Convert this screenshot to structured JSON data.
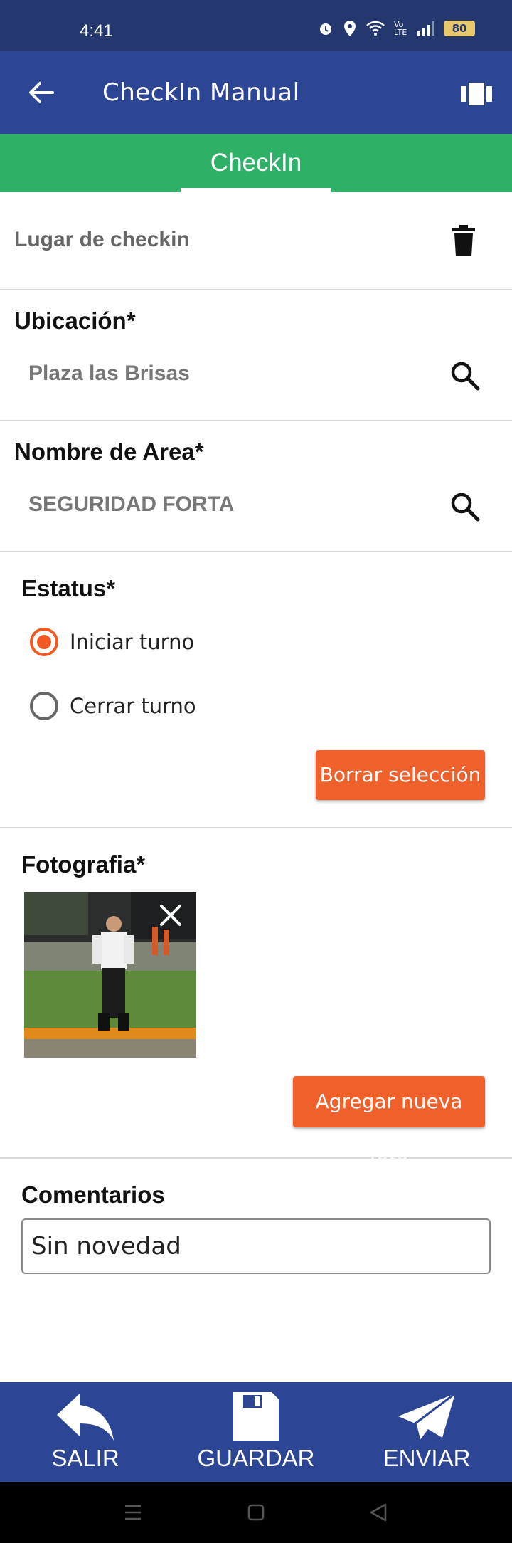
{
  "status_bar": {
    "time": "4:41",
    "battery": "80",
    "network": "Vo LTE"
  },
  "app_bar": {
    "title": "CheckIn Manual",
    "back_icon": "arrow-left-icon",
    "gallery_icon": "view-carousel-icon"
  },
  "tabs": [
    {
      "label": "CheckIn",
      "active": true
    }
  ],
  "place": {
    "label": "Lugar de checkin",
    "icon": "trash-icon"
  },
  "ubicacion": {
    "title": "Ubicación*",
    "value": "Plaza las Brisas",
    "icon": "search-icon"
  },
  "area": {
    "title": "Nombre de Area*",
    "value": "SEGURIDAD FORTA",
    "icon": "search-icon"
  },
  "estatus": {
    "title": "Estatus*",
    "options": [
      {
        "label": "Iniciar turno",
        "selected": true
      },
      {
        "label": "Cerrar turno",
        "selected": false
      }
    ],
    "clear_button": "Borrar selección"
  },
  "fotografia": {
    "title": "Fotografia*",
    "add_button": "Agregar nueva foto",
    "remove_icon": "close-icon"
  },
  "comentarios": {
    "title": "Comentarios",
    "value": "Sin novedad"
  },
  "bottom_nav": [
    {
      "label": "SALIR",
      "icon": "reply-icon"
    },
    {
      "label": "GUARDAR",
      "icon": "save-icon"
    },
    {
      "label": "ENVIAR",
      "icon": "send-icon"
    }
  ],
  "colors": {
    "primary": "#2d4595",
    "status_bar": "#24386f",
    "tab_green": "#2fb067",
    "accent_orange": "#f0602a"
  }
}
